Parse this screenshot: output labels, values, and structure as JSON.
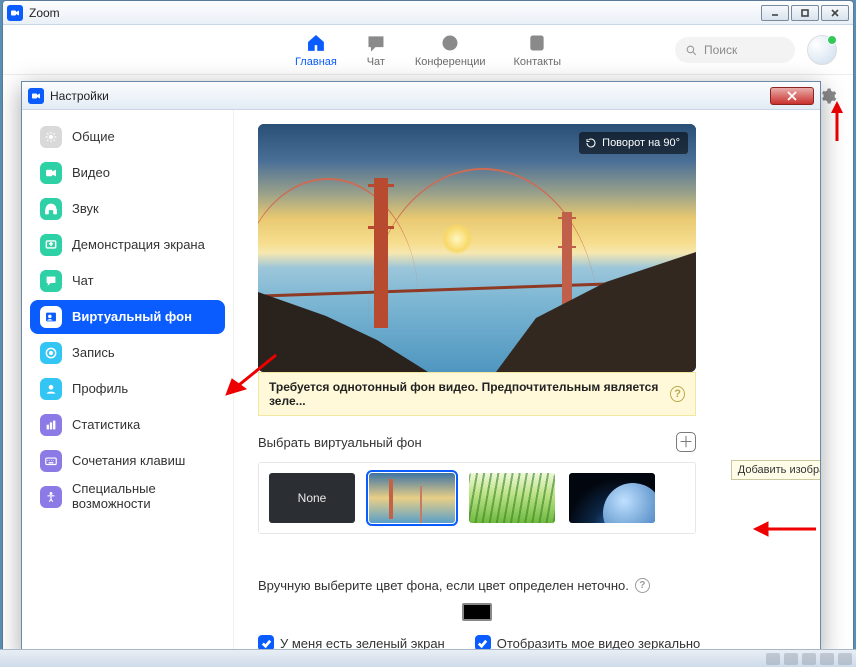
{
  "outer": {
    "title": "Zoom"
  },
  "nav": {
    "home": "Главная",
    "chat": "Чат",
    "meetings": "Конференции",
    "contacts": "Контакты",
    "search_placeholder": "Поиск"
  },
  "settings": {
    "title": "Настройки",
    "sidebar": {
      "general": "Общие",
      "video": "Видео",
      "audio": "Звук",
      "share": "Демонстрация экрана",
      "chat": "Чат",
      "vbg": "Виртуальный фон",
      "record": "Запись",
      "profile": "Профиль",
      "stats": "Статистика",
      "shortcuts": "Сочетания клавиш",
      "accessibility": "Специальные возможности"
    },
    "preview": {
      "rotate": "Поворот на 90°"
    },
    "warn": "Требуется однотонный фон видео. Предпочтительным является зеле...",
    "pick_label": "Выбрать виртуальный фон",
    "tooltip_add": "Добавить изображение",
    "none_label": "None",
    "manual_label": "Вручную выберите цвет фона, если цвет определен неточно.",
    "green_screen": "У меня есть зеленый экран",
    "mirror": "Отобразить мое видео зеркально"
  }
}
